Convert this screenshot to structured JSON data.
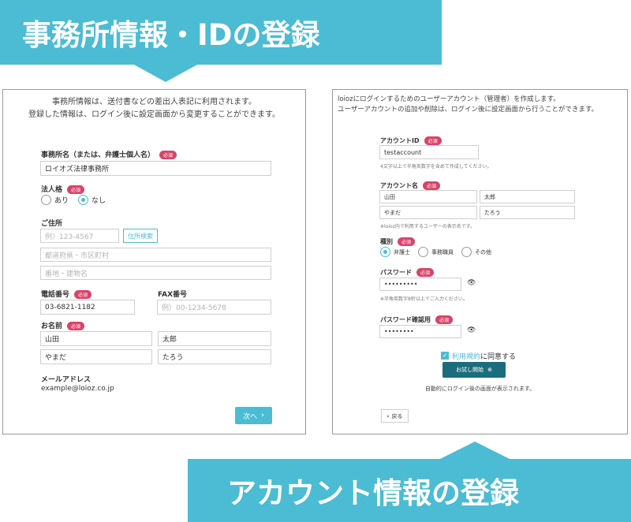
{
  "banners": {
    "top": "事務所情報・IDの登録",
    "bottom": "アカウント情報の登録"
  },
  "left": {
    "intro_line1": "事務所情報は、送付書などの差出人表記に利用されます。",
    "intro_line2": "登録した情報は、ログイン後に設定画面から変更することができます。",
    "office_name_label": "事務所名（または、弁護士個人名）",
    "required": "必須",
    "office_name_value": "ロイオズ法律事務所",
    "corp_label": "法人格",
    "corp_yes": "あり",
    "corp_no": "なし",
    "address_label": "ご住所",
    "zip_placeholder": "例）123-4567",
    "address_search": "住所検索",
    "pref_placeholder": "都道府県・市区町村",
    "building_placeholder": "番地・建物名",
    "phone_label": "電話番号",
    "phone_value": "03-6821-1182",
    "fax_label": "FAX番号",
    "fax_placeholder": "例）00-1234-5678",
    "name_label": "お名前",
    "last_name": "山田",
    "first_name": "太郎",
    "last_kana": "やまだ",
    "first_kana": "たろう",
    "email_label": "メールアドレス",
    "email_value": "example@loioz.co.jp",
    "next_button": "次へ",
    "next_icon": "chevron-right-icon"
  },
  "right": {
    "intro_line1": "loiozにログインするためのユーザーアカウント（管理者）を作成します。",
    "intro_line2": "ユーザーアカウントの追加や削除は、ログイン後に設定画面から行うことができます。",
    "account_id_label": "アカウントID",
    "required": "必須",
    "account_id_value": "testaccount",
    "account_id_hint": "4文字以上で半角英数字を含めて作成してください。",
    "account_name_label": "アカウント名",
    "last_name": "山田",
    "first_name": "太郎",
    "last_kana": "やまだ",
    "first_kana": "たろう",
    "account_name_hint": "※loioz内で利用するユーザーの表示名です。",
    "type_label": "種別",
    "type_lawyer": "弁護士",
    "type_clerk": "事務職員",
    "type_other": "その他",
    "password_label": "パスワード",
    "password_value": "•••••••••",
    "password_hint": "※半角英数字8桁以上でご入力ください。",
    "password_confirm_label": "パスワード確認用",
    "password_confirm_value": "••••••••",
    "terms_link": "利用規約",
    "terms_text": "に同意する",
    "trial_button": "お試し開始",
    "after_login_note": "自動的にログイン後の画面が表示されます。",
    "back_button": "戻る"
  },
  "colors": {
    "accent": "#4bbcd3",
    "required_badge": "#d9436a",
    "dark_button": "#1b6d7d"
  }
}
